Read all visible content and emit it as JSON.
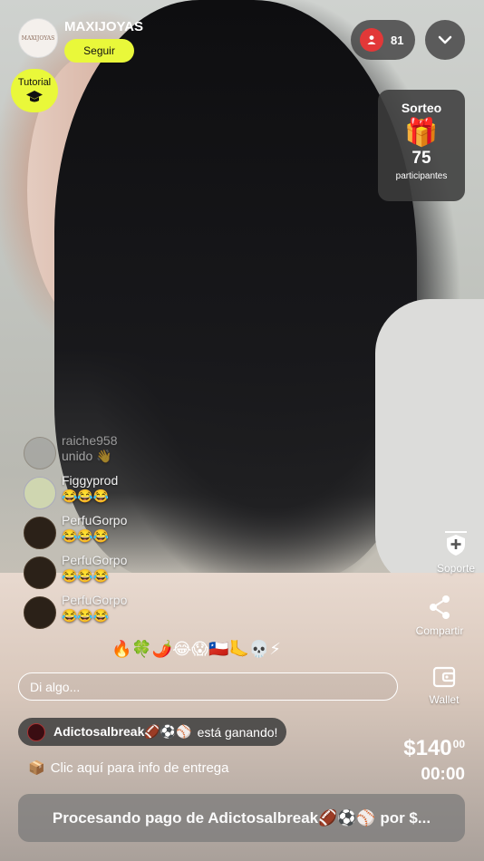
{
  "shop": {
    "name": "MAXIJOYAS",
    "follow_label": "Seguir",
    "logo_text": "MAXIJOYAS"
  },
  "tutorial": {
    "label": "Tutorial"
  },
  "viewers": {
    "count": "81"
  },
  "raffle": {
    "title": "Sorteo",
    "icon": "🎁",
    "count": "75",
    "label": "participantes"
  },
  "chat": [
    {
      "user": "raiche958",
      "text": "unido 👋",
      "avatar": "faded"
    },
    {
      "user": "Figgyprod",
      "text": "😂😂😂",
      "avatar": "green"
    },
    {
      "user": "PerfuGorpo",
      "text": "😂😂😂",
      "avatar": "brand"
    },
    {
      "user": "PerfuGorpo",
      "text": "😂😂😂",
      "avatar": "brand"
    },
    {
      "user": "PerfuGorpo",
      "text": "😂😂😂",
      "avatar": "brand"
    }
  ],
  "reactions": "🔥🍀🌶️😂😱🇨🇱🦶💀⚡",
  "input": {
    "placeholder": "Di algo..."
  },
  "actions": {
    "support": "Soporte",
    "share": "Compartir",
    "wallet": "Wallet"
  },
  "winner": {
    "name": "Adictosalbreak🏈⚽⚾",
    "status": "está ganando!"
  },
  "delivery": {
    "icon": "📦",
    "text": "Clic aquí para info de entrega"
  },
  "price": {
    "main": "$140",
    "cents": "00"
  },
  "timer": "00:00",
  "banner": {
    "text": "Procesando pago de Adictosalbreak🏈⚽⚾ por $..."
  },
  "colors": {
    "accent": "#e9f83a",
    "live_red": "#e23838"
  }
}
